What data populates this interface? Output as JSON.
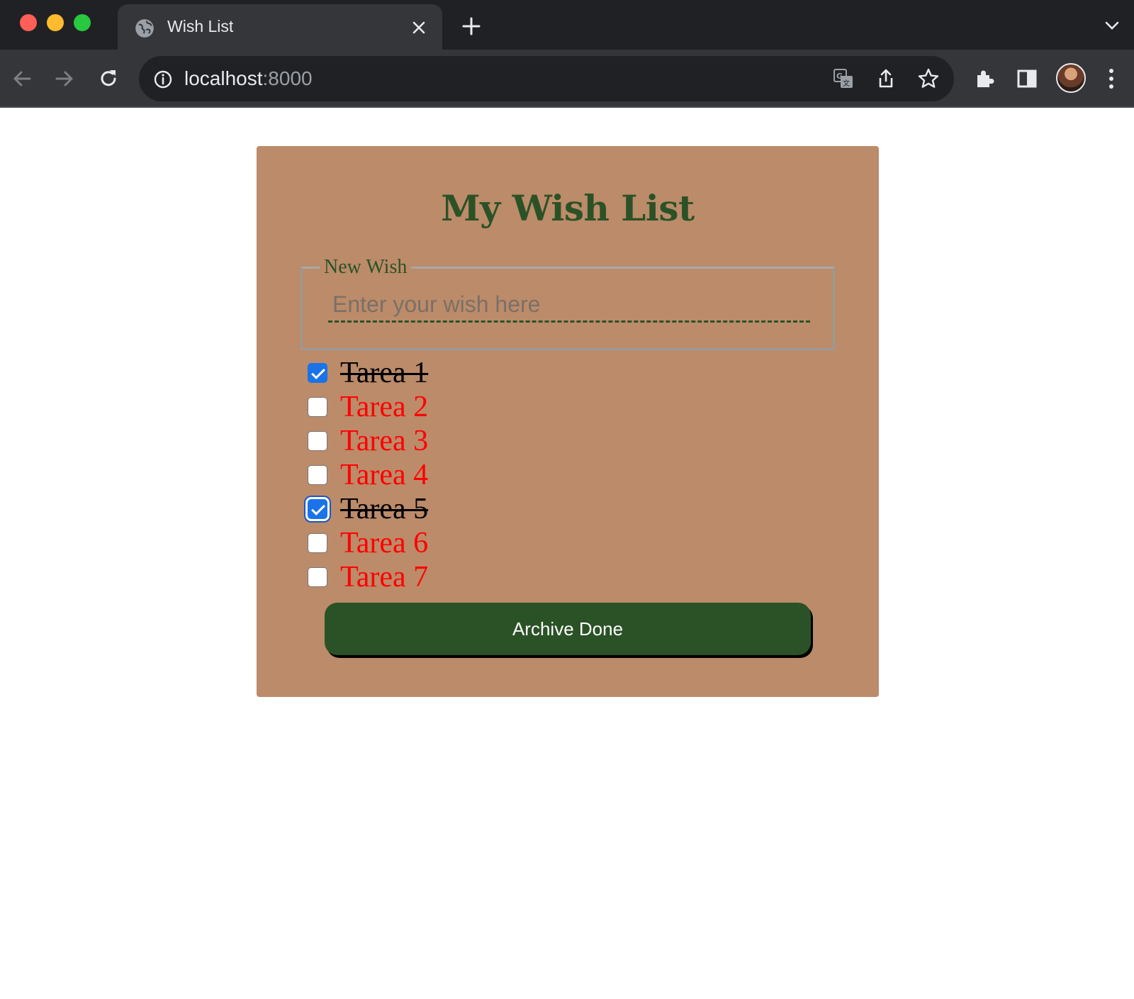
{
  "browser": {
    "tab_title": "Wish List",
    "url_host": "localhost",
    "url_port": ":8000"
  },
  "page": {
    "heading": "My Wish List",
    "new_wish": {
      "legend": "New Wish",
      "placeholder": "Enter your wish here",
      "value": ""
    },
    "items": [
      {
        "label": "Tarea 1",
        "done": true
      },
      {
        "label": "Tarea 2",
        "done": false
      },
      {
        "label": "Tarea 3",
        "done": false
      },
      {
        "label": "Tarea 4",
        "done": false
      },
      {
        "label": "Tarea 5",
        "done": true,
        "focused": true
      },
      {
        "label": "Tarea 6",
        "done": false
      },
      {
        "label": "Tarea 7",
        "done": false
      }
    ],
    "archive_label": "Archive Done"
  },
  "colors": {
    "card_background": "#bc8b6a",
    "heading_green": "#2b5226",
    "pending_red": "#ff0000",
    "done_black": "#000000",
    "checkbox_blue": "#1a73e8"
  },
  "icons": [
    "globe-icon",
    "close-icon",
    "plus-icon",
    "chevron-down-icon",
    "back-arrow-icon",
    "forward-arrow-icon",
    "reload-icon",
    "info-icon",
    "translate-icon",
    "share-icon",
    "star-icon",
    "extensions-icon",
    "side-panel-icon",
    "more-icon"
  ]
}
